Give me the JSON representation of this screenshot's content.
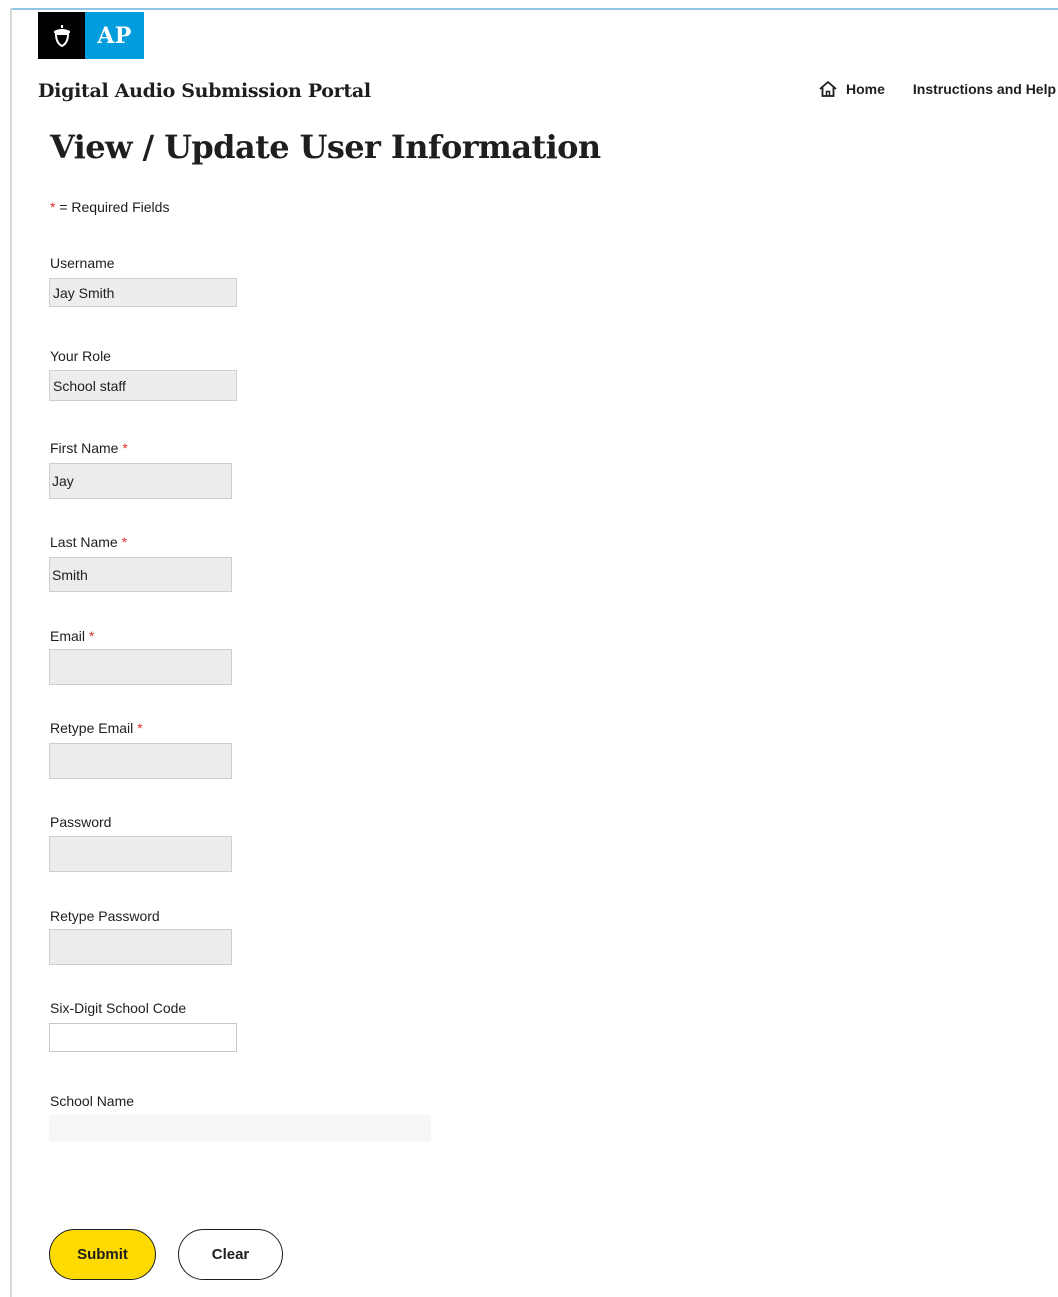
{
  "header": {
    "logo_text": "AP",
    "portal_title": "Digital Audio Submission Portal",
    "nav": {
      "home_label": "Home",
      "help_label": "Instructions and Help"
    }
  },
  "page_title": "View / Update User Information",
  "required_note": {
    "asterisk": "*",
    "text": " = Required Fields"
  },
  "form": {
    "username": {
      "label": "Username",
      "value": "Jay Smith"
    },
    "role": {
      "label": "Your Role",
      "value": "School staff"
    },
    "first_name": {
      "label": "First Name",
      "required": "*",
      "value": "Jay"
    },
    "last_name": {
      "label": "Last Name",
      "required": "*",
      "value": "Smith"
    },
    "email": {
      "label": "Email",
      "required": "*",
      "value": ""
    },
    "retype_email": {
      "label": "Retype Email",
      "required": "*",
      "value": ""
    },
    "password": {
      "label": "Password",
      "value": ""
    },
    "retype_password": {
      "label": "Retype Password",
      "value": ""
    },
    "school_code": {
      "label": "Six-Digit School Code",
      "value": ""
    },
    "school_name": {
      "label": "School Name",
      "value": ""
    }
  },
  "buttons": {
    "submit_label": "Submit",
    "clear_label": "Clear"
  },
  "colors": {
    "brand_blue": "#009cde",
    "submit_yellow": "#fedb00",
    "required_red": "#d9312d"
  },
  "icons": {
    "logo": "acorn-icon",
    "home": "home-icon"
  }
}
